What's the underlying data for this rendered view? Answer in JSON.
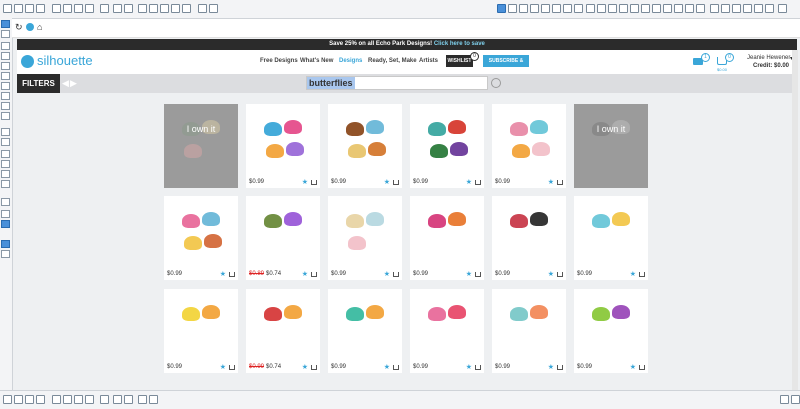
{
  "promo": {
    "text": "Save 25% on all Echo Park Designs!",
    "link": "Click here to save"
  },
  "brand": {
    "name": "silhouette"
  },
  "nav": {
    "items": [
      "Free Designs",
      "What's New",
      "Designs",
      "Ready, Set, Make",
      "Artists"
    ],
    "active": "Designs",
    "wishlist": "WISHLIST",
    "wishlist_count": "0",
    "subscribe": "SUBSCRIBE & SAVE"
  },
  "user": {
    "name": "Jeanie Hewener",
    "credit": "Credit: $0.00",
    "mail_count": "1",
    "cart_count": "0",
    "cart_amount": "$0.00"
  },
  "filters": {
    "label": "FILTERS"
  },
  "search": {
    "value": "butterflies"
  },
  "tiles": [
    {
      "owned": "I own it"
    },
    {
      "price": "$0.99"
    },
    {
      "price": "$0.99"
    },
    {
      "price": "$0.99"
    },
    {
      "price": "$0.99"
    },
    {
      "owned": "I own it"
    },
    {
      "price": "$0.99"
    },
    {
      "old": "$0.89",
      "price": "$0.74"
    },
    {
      "price": "$0.99"
    },
    {
      "price": "$0.99"
    },
    {
      "price": "$0.99"
    },
    {
      "price": "$0.99"
    },
    {
      "price": "$0.99"
    },
    {
      "old": "$0.99",
      "price": "$0.74"
    },
    {
      "price": "$0.99"
    },
    {
      "price": "$0.99"
    },
    {
      "price": "$0.99"
    },
    {
      "price": "$0.99"
    }
  ],
  "colors": {
    "accent": "#3aa6d8",
    "sale": "#dd2222",
    "promo_bg": "#2b2b2b"
  }
}
